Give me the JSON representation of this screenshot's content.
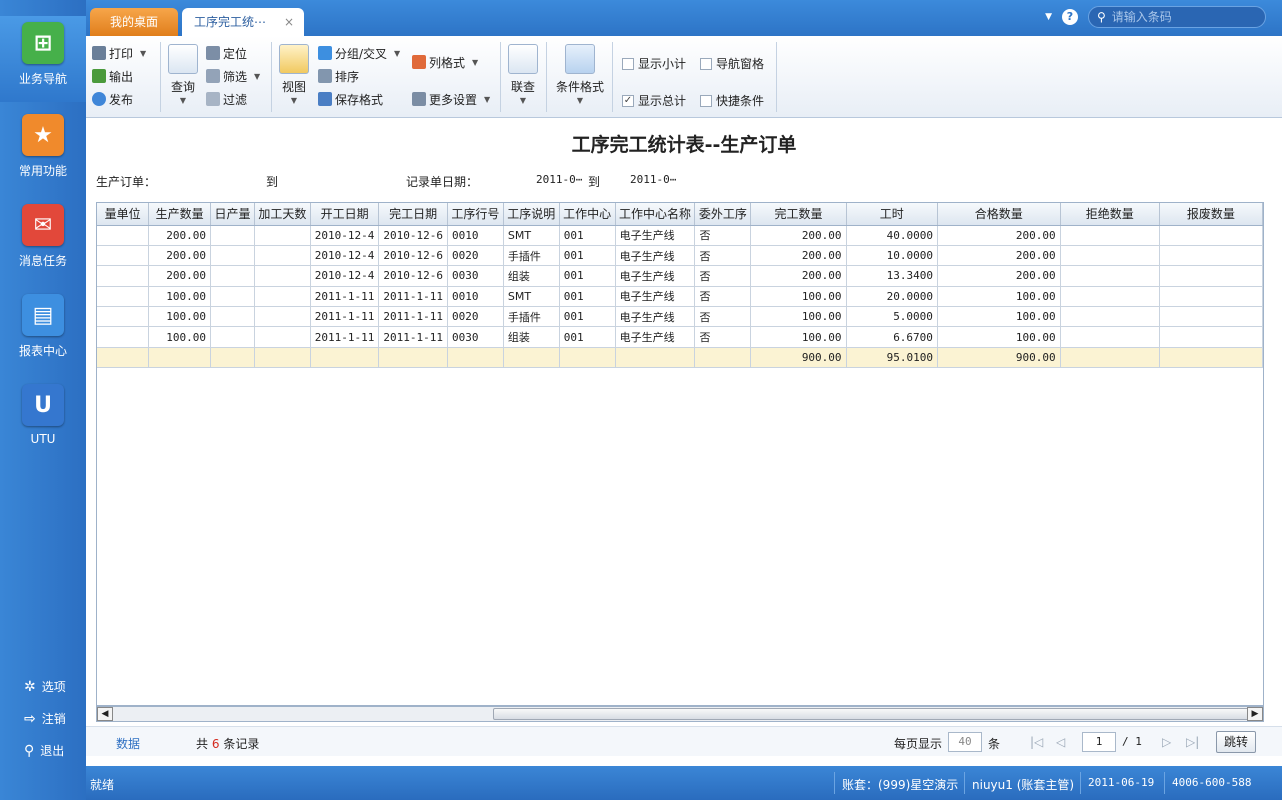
{
  "sidebar": {
    "items": [
      {
        "label": "业务导航",
        "icon": "business-nav-icon",
        "color": "#46b04a"
      },
      {
        "label": "常用功能",
        "icon": "star-icon",
        "color": "#f08a2c"
      },
      {
        "label": "消息任务",
        "icon": "message-icon",
        "color": "#e2483a"
      },
      {
        "label": "报表中心",
        "icon": "report-icon",
        "color": "#3d8fe0"
      },
      {
        "label": "UTU",
        "icon": "utu-icon",
        "color": "#3577cf"
      }
    ],
    "bottom": [
      {
        "label": "选项",
        "icon": "gear-icon"
      },
      {
        "label": "注销",
        "icon": "logout-icon"
      },
      {
        "label": "退出",
        "icon": "key-icon"
      }
    ]
  },
  "tabs": {
    "home": "我的桌面",
    "report": "工序完工统⋯",
    "close": "×"
  },
  "search": {
    "placeholder": "请输入条码",
    "help": "?"
  },
  "toolbar": {
    "print": "打印",
    "export": "输出",
    "publish": "发布",
    "query": "查询",
    "locate": "定位",
    "filter_sel": "筛选",
    "filter": "过滤",
    "view": "视图",
    "group": "分组/交叉",
    "sort": "排序",
    "save_format": "保存格式",
    "col_format": "列格式",
    "more_settings": "更多设置",
    "link_query": "联查",
    "cond_format": "条件格式",
    "show_subtotal": "显示小计",
    "nav_pane": "导航窗格",
    "show_total": "显示总计",
    "quick_cond": "快捷条件"
  },
  "report": {
    "title": "工序完工统计表--生产订单",
    "filter_order_label": "生产订单：",
    "filter_to_1": "到",
    "filter_date_label": "记录单日期：",
    "filter_date_from": "2011-0⋯",
    "filter_to_2": "到",
    "filter_date_to": "2011-0⋯"
  },
  "table": {
    "columns": [
      "量单位",
      "生产数量",
      "日产量",
      "加工天数",
      "开工日期",
      "完工日期",
      "工序行号",
      "工序说明",
      "工作中心",
      "工作中心名称",
      "委外工序",
      "完工数量",
      "工时",
      "合格数量",
      "拒绝数量",
      "报废数量"
    ],
    "rows": [
      [
        "",
        "200.00",
        "",
        "",
        "2010-12-4",
        "2010-12-6",
        "0010",
        "SMT",
        "001",
        "电子生产线",
        "否",
        "200.00",
        "40.0000",
        "200.00",
        "",
        ""
      ],
      [
        "",
        "200.00",
        "",
        "",
        "2010-12-4",
        "2010-12-6",
        "0020",
        "手插件",
        "001",
        "电子生产线",
        "否",
        "200.00",
        "10.0000",
        "200.00",
        "",
        ""
      ],
      [
        "",
        "200.00",
        "",
        "",
        "2010-12-4",
        "2010-12-6",
        "0030",
        "组装",
        "001",
        "电子生产线",
        "否",
        "200.00",
        "13.3400",
        "200.00",
        "",
        ""
      ],
      [
        "",
        "100.00",
        "",
        "",
        "2011-1-11",
        "2011-1-11",
        "0010",
        "SMT",
        "001",
        "电子生产线",
        "否",
        "100.00",
        "20.0000",
        "100.00",
        "",
        ""
      ],
      [
        "",
        "100.00",
        "",
        "",
        "2011-1-11",
        "2011-1-11",
        "0020",
        "手插件",
        "001",
        "电子生产线",
        "否",
        "100.00",
        "5.0000",
        "100.00",
        "",
        ""
      ],
      [
        "",
        "100.00",
        "",
        "",
        "2011-1-11",
        "2011-1-11",
        "0030",
        "组装",
        "001",
        "电子生产线",
        "否",
        "100.00",
        "6.6700",
        "100.00",
        "",
        ""
      ]
    ],
    "total": [
      "",
      "",
      "",
      "",
      "",
      "",
      "",
      "",
      "",
      "",
      "",
      "900.00",
      "95.0100",
      "900.00",
      "",
      ""
    ]
  },
  "pager": {
    "data_tab": "数据",
    "total_prefix": "共",
    "total_count": "6",
    "total_suffix": "条记录",
    "per_page_label": "每页显示",
    "per_page": "40",
    "per_page_unit": "条",
    "current_page": "1",
    "page_total": "/ 1",
    "jump": "跳转"
  },
  "status": {
    "ready": "就绪",
    "account": "账套：(999)星空演示",
    "user": "niuyu1 (账套主管)",
    "date": "2011-06-19",
    "phone": "4006-600-588"
  }
}
